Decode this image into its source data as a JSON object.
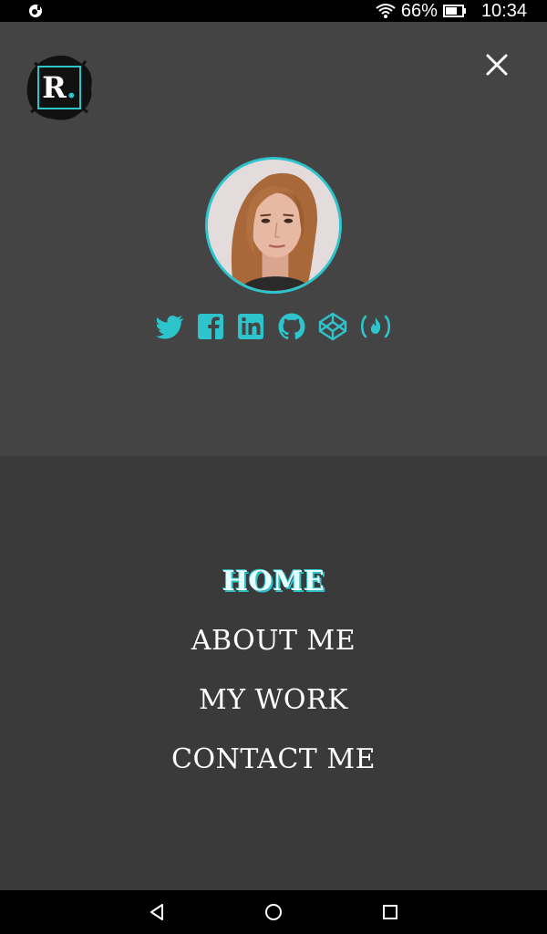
{
  "status_bar": {
    "battery_percent": "66%",
    "time": "10:34",
    "icons": [
      "notification-icon",
      "wifi-icon",
      "battery-icon"
    ]
  },
  "header": {
    "logo_letter": "R",
    "logo_dot": ".",
    "close_icon": "close-icon"
  },
  "profile": {
    "avatar": "profile-photo"
  },
  "social": {
    "icons": [
      "twitter-icon",
      "facebook-icon",
      "linkedin-icon",
      "github-icon",
      "codepen-icon",
      "freecodecamp-icon"
    ]
  },
  "menu": {
    "items": [
      {
        "label": "HOME",
        "active": true
      },
      {
        "label": "ABOUT ME",
        "active": false
      },
      {
        "label": "MY WORK",
        "active": false
      },
      {
        "label": "CONTACT ME",
        "active": false
      }
    ]
  },
  "nav_bar": {
    "icons": [
      "back-icon",
      "home-icon",
      "recents-icon"
    ]
  },
  "colors": {
    "accent": "#2ec4cc",
    "top_panel": "#444444",
    "menu_panel": "#3a3a3a"
  }
}
